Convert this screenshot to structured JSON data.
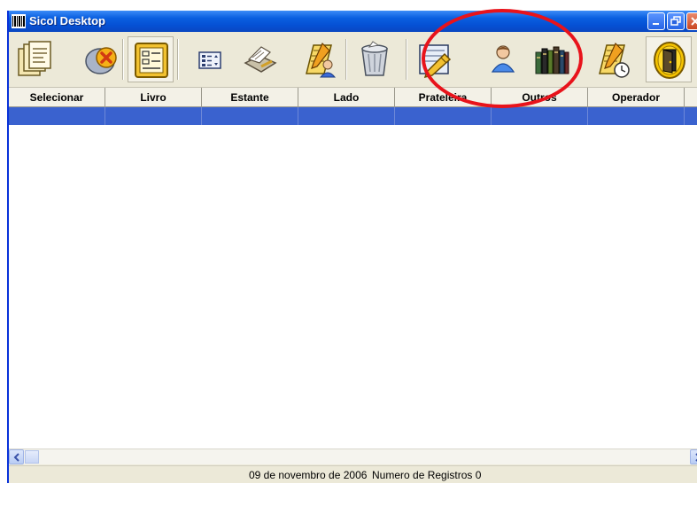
{
  "window": {
    "title": "Sicol Desktop",
    "controls": [
      "minimize-icon",
      "restore-icon",
      "close-icon"
    ]
  },
  "toolbar": {
    "buttons": [
      {
        "name": "new-record-button",
        "icon": "documents-icon"
      },
      {
        "name": "delete-button",
        "icon": "delete-x-icon"
      },
      {
        "name": "form-button",
        "icon": "form-list-icon",
        "active": true
      },
      {
        "name": "list-options-button",
        "icon": "list-select-icon"
      },
      {
        "name": "print-button",
        "icon": "print-stack-icon"
      },
      {
        "name": "edit-user-button",
        "icon": "notepad-user-icon"
      },
      {
        "name": "trash-button",
        "icon": "trash-icon"
      },
      {
        "name": "report-button",
        "icon": "report-edit-icon"
      },
      {
        "name": "user-button",
        "icon": "user-icon"
      },
      {
        "name": "books-button",
        "icon": "books-icon"
      },
      {
        "name": "history-button",
        "icon": "notepad-clock-icon"
      },
      {
        "name": "exit-button",
        "icon": "exit-door-icon"
      }
    ]
  },
  "grid": {
    "columns": [
      "Selecionar",
      "Livro",
      "Estante",
      "Lado",
      "Prateleira",
      "Outros",
      "Operador"
    ],
    "rows": []
  },
  "statusbar": {
    "date": "09 de novembro de 2006",
    "records": "Numero de Registros 0"
  },
  "colors": {
    "title_bar": "#0a5fe0",
    "selected_row": "#3a62cf",
    "highlight_circle": "#e8131b",
    "background": "#ece9d8"
  }
}
